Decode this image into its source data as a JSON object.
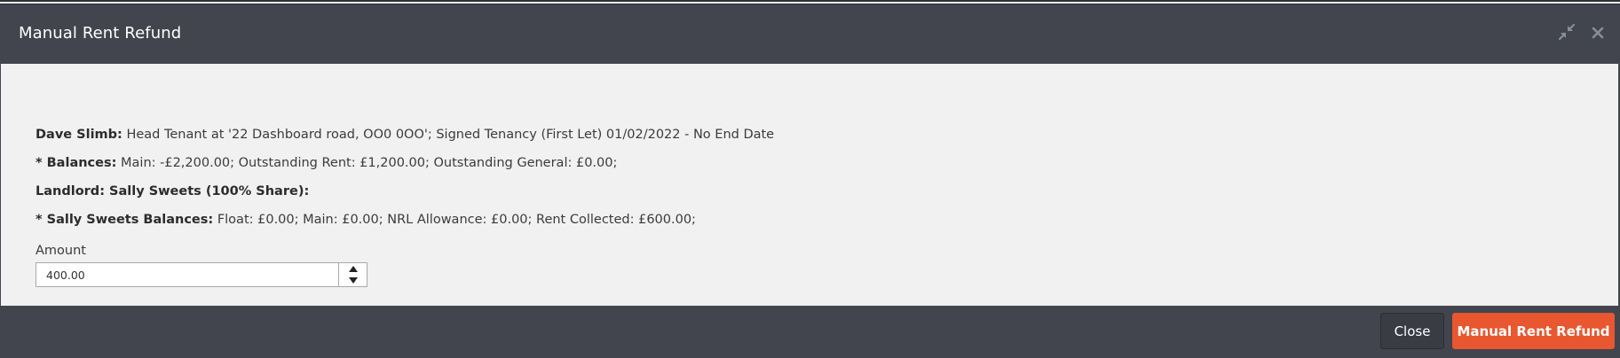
{
  "modal": {
    "title": "Manual Rent Refund",
    "icons": {
      "compress": "compress-icon",
      "close": "close-x-icon"
    }
  },
  "tenant": {
    "name_label": "Dave Slimb:",
    "description": "Head Tenant at '22 Dashboard road, OO0 0OO'; Signed Tenancy (First Let) 01/02/2022 - No End Date"
  },
  "balances": {
    "label": "* Balances:",
    "text": "Main: -£2,200.00; Outstanding Rent: £1,200.00; Outstanding General: £0.00;"
  },
  "landlord": {
    "label": "Landlord: Sally Sweets (100% Share):"
  },
  "landlord_balances": {
    "label": "* Sally Sweets Balances:",
    "text": "Float: £0.00; Main: £0.00; NRL Allowance: £0.00; Rent Collected: £600.00;"
  },
  "amount": {
    "label": "Amount",
    "value": "400.00"
  },
  "footer": {
    "close_label": "Close",
    "submit_label": "Manual Rent Refund"
  },
  "colors": {
    "header_bg": "#42454d",
    "body_bg": "#f1f1f1",
    "accent": "#e8572f"
  }
}
